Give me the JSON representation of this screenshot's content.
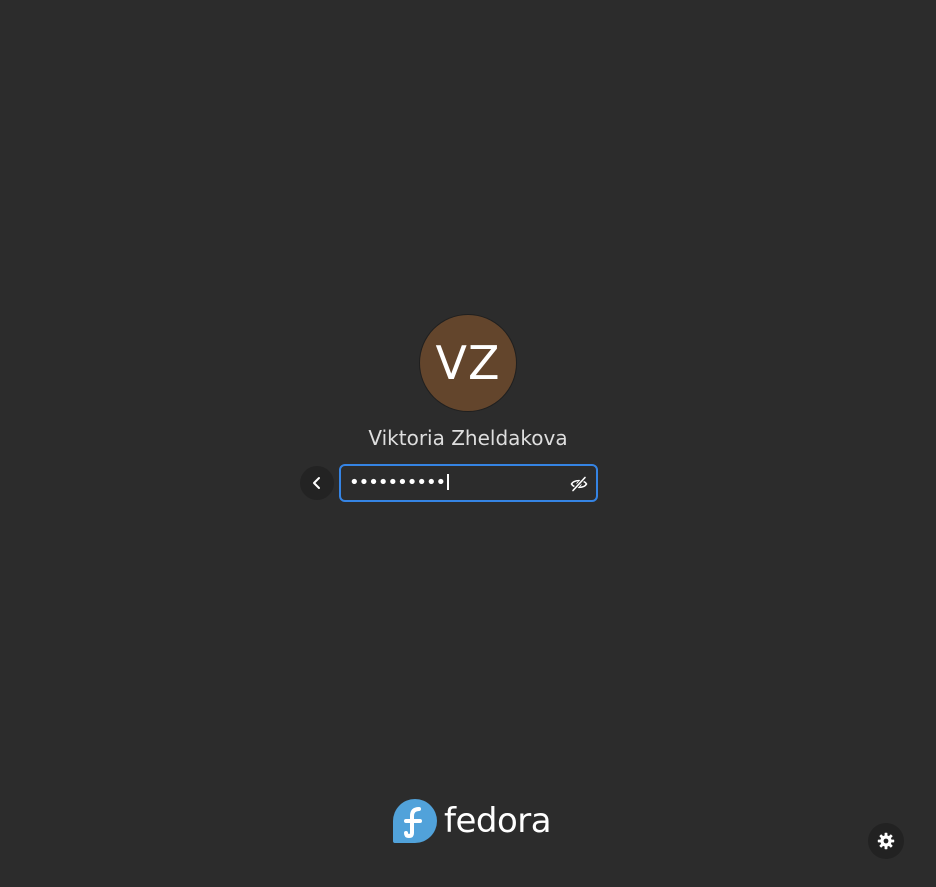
{
  "user": {
    "initials": "VZ",
    "full_name": "Viktoria Zheldakova",
    "avatar_color": "#63452c"
  },
  "password": {
    "masked_value": "••••••••••",
    "focus_color": "#3584e4"
  },
  "icons": {
    "back": "chevron-left-icon",
    "reveal": "eye-slash-icon",
    "settings": "gear-icon",
    "logo": "fedora-logo"
  },
  "branding": {
    "logo_text": "fedora",
    "logo_color": "#51a2da"
  },
  "background_color": "#2c2c2c"
}
